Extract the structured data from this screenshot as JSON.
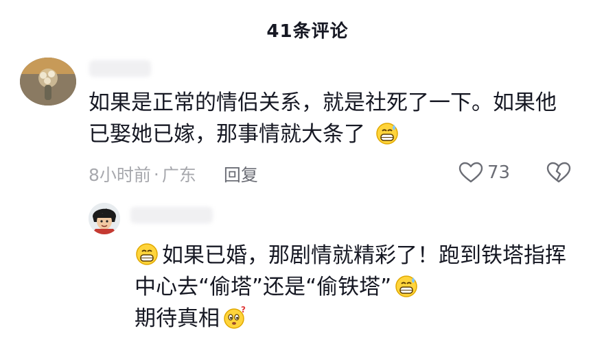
{
  "header": {
    "title": "41条评论"
  },
  "comment": {
    "text": "如果是正常的情侣关系，就是社死了一下。如果他已娶她已嫁，那事情就大条了",
    "time": "8小时前",
    "separator": "·",
    "location": "广东",
    "reply_label": "回复",
    "like_count": "73",
    "emoji": "sweat-grin"
  },
  "reply": {
    "text": "如果已婚，那剧情就精彩了！跑到铁塔指挥中心去“偷塔”还是“偷铁塔”",
    "text2": "期待真相",
    "emojis": [
      "grin",
      "sweat-grin",
      "thinking"
    ]
  }
}
